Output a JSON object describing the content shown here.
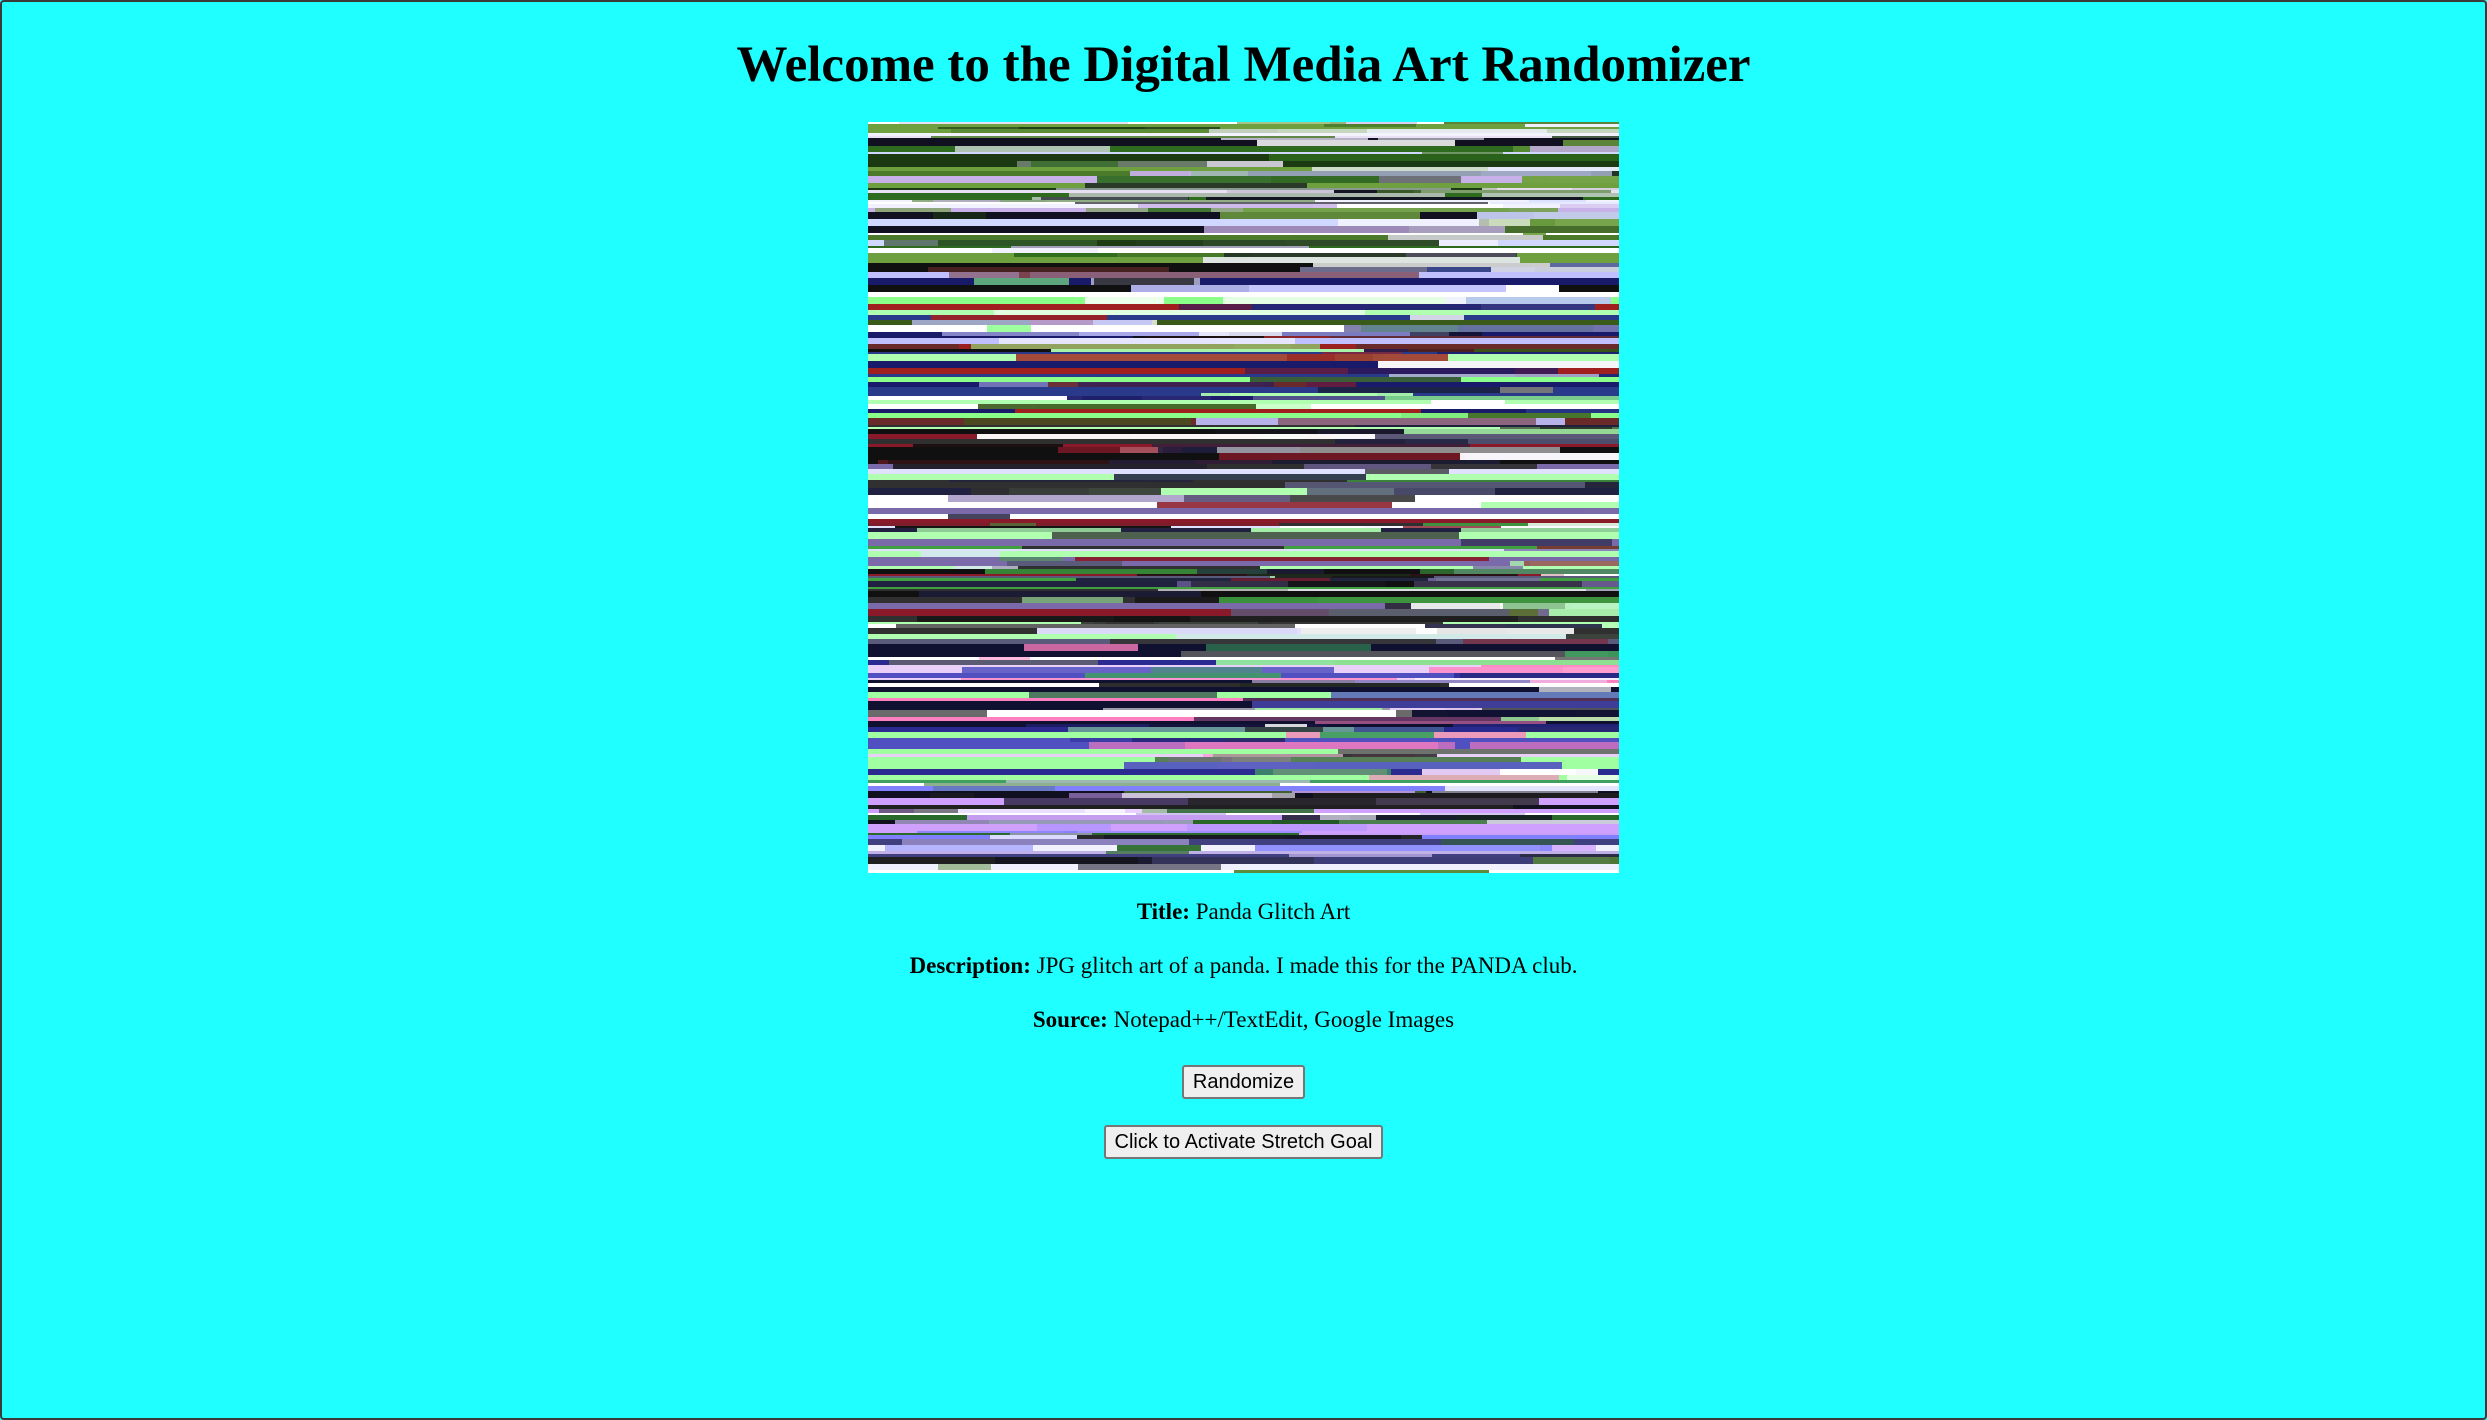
{
  "page": {
    "heading": "Welcome to the Digital Media Art Randomizer",
    "background_color": "#20ffff"
  },
  "artwork": {
    "title_label": "Title:",
    "title": "Panda Glitch Art",
    "description_label": "Description:",
    "description": "JPG glitch art of a panda. I made this for the PANDA club.",
    "source_label": "Source:",
    "source": "Notepad++/TextEdit, Google Images"
  },
  "buttons": {
    "randomize_label": "Randomize",
    "stretch_goal_label": "Click to Activate Stretch Goal"
  }
}
